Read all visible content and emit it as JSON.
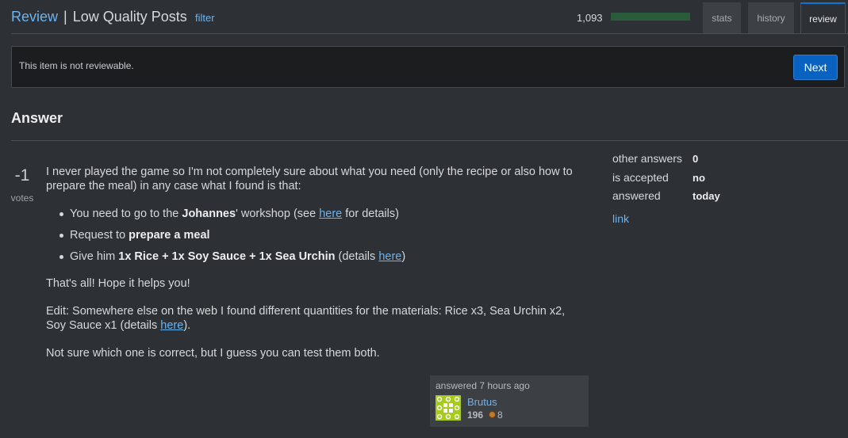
{
  "header": {
    "review_label": "Review",
    "separator": "|",
    "queue_name": "Low Quality Posts",
    "filter_label": "filter",
    "review_count": "1,093",
    "progress_fraction": 1.0,
    "progress_color": "#2b5b3a",
    "tabs": [
      {
        "label": "stats",
        "active": false
      },
      {
        "label": "history",
        "active": false
      },
      {
        "label": "review",
        "active": true
      }
    ]
  },
  "notice": {
    "message": "This item is not reviewable.",
    "next_label": "Next"
  },
  "answer": {
    "heading": "Answer",
    "votes": "-1",
    "votes_label": "votes",
    "body": {
      "intro": "I never played the game so I'm not completely sure about what you need (only the recipe or also how to prepare the meal) in any case what I found is that:",
      "bullets": [
        {
          "pre": "You need to go to the ",
          "bold": "Johannes",
          "mid": "' workshop (see ",
          "link": "here",
          "post": " for details)"
        },
        {
          "pre": "Request to ",
          "bold": "prepare a meal"
        },
        {
          "pre": "Give him ",
          "bold": "1x Rice + 1x Soy Sauce + 1x Sea Urchin",
          "mid": " (details ",
          "link": "here",
          "post": ")"
        }
      ],
      "p2": "That's all! Hope it helps you!",
      "p3_pre": "Edit: Somewhere else on the web I found different quantities for the materials: Rice x3, Sea Urchin x2, Soy Sauce x1 (details ",
      "p3_link": "here",
      "p3_post": ").",
      "p4": "Not sure which one is correct, but I guess you can test them both."
    },
    "signature": {
      "action_time": "answered 7 hours ago",
      "user_name": "Brutus",
      "reputation": "196",
      "bronze_badges": "8",
      "avatar_color": "#a5cc1a"
    }
  },
  "info": {
    "rows": [
      {
        "label": "other answers",
        "value": "0"
      },
      {
        "label": "is accepted",
        "value": "no"
      },
      {
        "label": "answered",
        "value": "today"
      }
    ],
    "link_label": "link"
  }
}
